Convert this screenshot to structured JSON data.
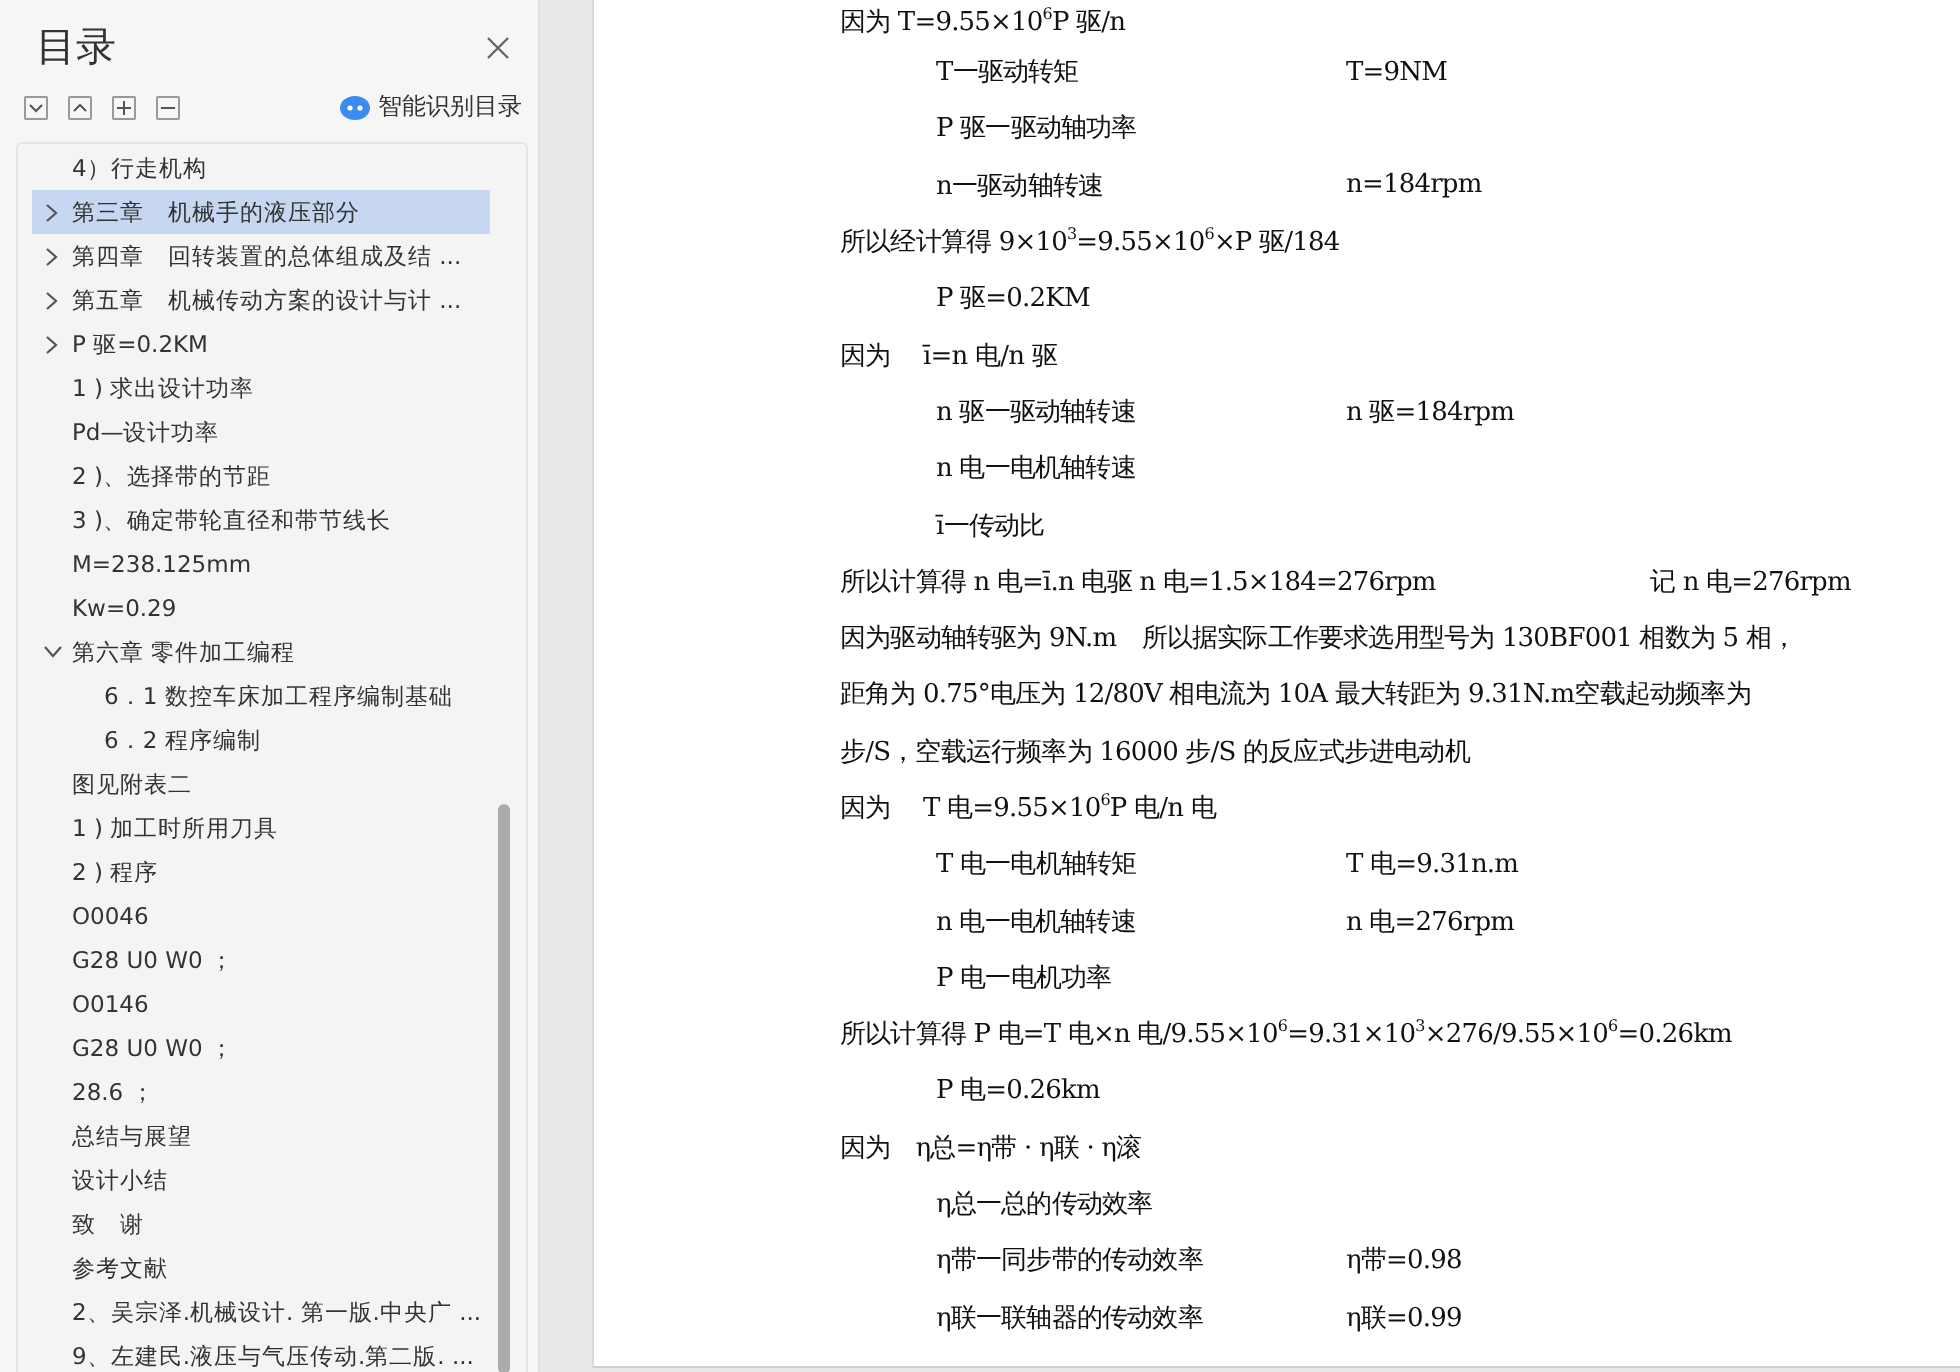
{
  "sidebar": {
    "title": "目录",
    "smart_button": {
      "label": "智能识别目录"
    },
    "items": [
      {
        "label": "4）行走机构",
        "selected": false
      },
      {
        "label": "第三章　机械手的液压部分",
        "selected": true,
        "expanded": false
      },
      {
        "label": "第四章　回转装置的总体组成及结 ...",
        "selected": false,
        "expanded": false
      },
      {
        "label": "第五章　机械传动方案的设计与计 ...",
        "selected": false,
        "expanded": false
      },
      {
        "label": "P 驱=0.2KM",
        "selected": false,
        "expanded": false
      },
      {
        "label": "1 ) 求出设计功率",
        "selected": false
      },
      {
        "label": "Pd—设计功率",
        "selected": false
      },
      {
        "label": "2 )、选择带的节距",
        "selected": false
      },
      {
        "label": "3 )、确定带轮直径和带节线长",
        "selected": false
      },
      {
        "label": "M=238.125mm",
        "selected": false
      },
      {
        "label": "Kw=0.29",
        "selected": false
      },
      {
        "label": "第六章 零件加工编程",
        "selected": false,
        "expanded": true,
        "children": [
          {
            "label": "6．1 数控车床加工程序编制基础",
            "selected": false
          },
          {
            "label": "6．2 程序编制",
            "selected": false
          }
        ]
      },
      {
        "label": "图见附表二",
        "selected": false
      },
      {
        "label": "1 ) 加工时所用刀具",
        "selected": false
      },
      {
        "label": "2 ) 程序",
        "selected": false
      },
      {
        "label": "O0046",
        "selected": false
      },
      {
        "label": "G28 U0 W0 ；",
        "selected": false
      },
      {
        "label": "O0146",
        "selected": false
      },
      {
        "label": "G28 U0 W0 ；",
        "selected": false
      },
      {
        "label": "28.6 ；",
        "selected": false
      },
      {
        "label": "总结与展望",
        "selected": false
      },
      {
        "label": "设计小结",
        "selected": false
      },
      {
        "label": "致　谢",
        "selected": false
      },
      {
        "label": "参考文献",
        "selected": false
      },
      {
        "label": "2、吴宗泽.机械设计. 第一版.中央广 ...",
        "selected": false
      },
      {
        "label": "9、左建民.液压与气压传动.第二版. ...",
        "selected": false
      }
    ]
  },
  "document": {
    "lines": [
      {
        "kind": "para",
        "text": "因为 T=9.55×10$^{6}$P 驱/n"
      },
      {
        "kind": "sub",
        "text": "T一驱动转矩",
        "value": "T=9NM"
      },
      {
        "kind": "sub",
        "text": "P 驱一驱动轴功率"
      },
      {
        "kind": "sub",
        "text": "n一驱动轴转速",
        "value": "n=184rpm"
      },
      {
        "kind": "para",
        "text": "所以经计算得 9×10$^{3}$=9.55×10$^{6}$×P 驱/184"
      },
      {
        "kind": "sub",
        "text": "P 驱=0.2KM"
      },
      {
        "kind": "para",
        "text": "因为　 ī=n 电/n 驱"
      },
      {
        "kind": "sub",
        "text": "n 驱一驱动轴转速",
        "value": "n 驱=184rpm"
      },
      {
        "kind": "sub",
        "text": "n 电一电机轴转速"
      },
      {
        "kind": "sub",
        "text": "ī一传动比"
      },
      {
        "kind": "para",
        "text": "所以计算得 n 电=ī.n 电驱 n 电=1.5×184=276rpm",
        "value": "记 n 电=276rpm"
      },
      {
        "kind": "para",
        "text": "因为驱动轴转驱为 9N.m　所以据实际工作要求选用型号为 130BF001 相数为 5 相，"
      },
      {
        "kind": "para",
        "text": "距角为 0.75°电压为 12/80V 相电流为 10A 最大转距为 9.31N.m空载起动频率为"
      },
      {
        "kind": "para",
        "text": "步/S，空载运行频率为 16000 步/S 的反应式步进电动机"
      },
      {
        "kind": "para",
        "text": "因为　 T 电=9.55×10$^{6}$P 电/n 电"
      },
      {
        "kind": "sub",
        "text": "T 电一电机轴转矩",
        "value": "T 电=9.31n.m"
      },
      {
        "kind": "sub",
        "text": "n 电一电机轴转速",
        "value": "n 电=276rpm"
      },
      {
        "kind": "sub",
        "text": "P 电一电机功率"
      },
      {
        "kind": "para",
        "text": "所以计算得 P 电=T 电×n 电/9.55×10$^{6}$=9.31×10$^{3}$×276/9.55×10$^{6}$=0.26km"
      },
      {
        "kind": "sub",
        "text": "P 电=0.26km"
      },
      {
        "kind": "para",
        "text": "因为　η总=η带 · η联 · η滚"
      },
      {
        "kind": "sub",
        "text": "η总一总的传动效率"
      },
      {
        "kind": "sub",
        "text": "η带一同步带的传动效率",
        "value": "η带=0.98"
      },
      {
        "kind": "sub",
        "text": "η联一联轴器的传动效率",
        "value": "η联=0.99"
      }
    ]
  }
}
